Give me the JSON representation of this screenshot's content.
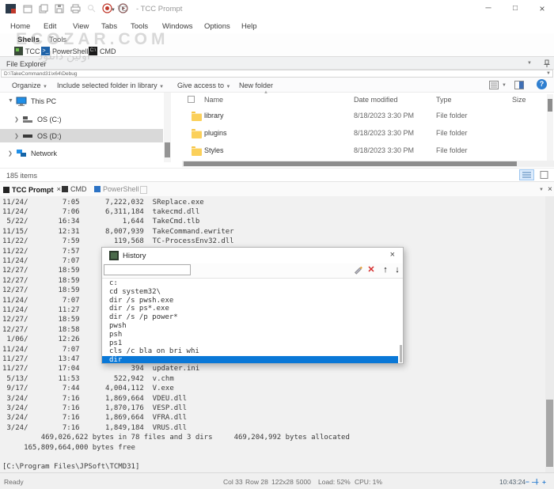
{
  "window": {
    "title": "- TCC Prompt",
    "qat_label": "TC",
    "minimize": "─",
    "maximize": "□",
    "close": "×"
  },
  "menu": {
    "items": [
      "Home",
      "Edit",
      "View",
      "Tabs",
      "Tools",
      "Windows",
      "Options",
      "Help"
    ]
  },
  "ribbon": {
    "groups": [
      "Shells",
      "Tools"
    ],
    "shells": [
      "TCC",
      "PowerShell",
      "CMD"
    ]
  },
  "watermark": {
    "line1": "ECOZAR.COM",
    "line2": "اولین دانلود"
  },
  "explorer": {
    "panel_title": "File Explorer",
    "address": "D:\\TakeCommand31\\x64\\Debug",
    "toolbar": {
      "organize": "Organize",
      "include": "Include selected folder in library",
      "give_access": "Give access to",
      "new_folder": "New folder"
    },
    "tree": {
      "items": [
        "This PC",
        "OS (C:)",
        "OS (D:)",
        "Network"
      ]
    },
    "columns": [
      "Name",
      "Date modified",
      "Type",
      "Size"
    ],
    "files": [
      {
        "name": "library",
        "date": "8/18/2023 3:30 PM",
        "type": "File folder"
      },
      {
        "name": "plugins",
        "date": "8/18/2023 3:30 PM",
        "type": "File folder"
      },
      {
        "name": "Styles",
        "date": "8/18/2023 3:30 PM",
        "type": "File folder"
      }
    ],
    "status": "185 items"
  },
  "console_tabs": {
    "tab1": "TCC Prompt",
    "tab1_close": "×",
    "tab2": "CMD",
    "tab3": "PowerShell"
  },
  "console": {
    "lines": [
      "11/24/        7:05      7,222,032  SReplace.exe",
      "11/24/        7:06      6,311,184  takecmd.dll",
      " 5/22/       16:34          1,644  TakeCmd.tlb",
      "11/15/       12:31      8,007,939  TakeCommand.ewriter",
      "11/22/        7:59        119,568  TC-ProcessEnv32.dll",
      "11/22/        7:57",
      "11/24/        7:07",
      "12/27/       18:59",
      "12/27/       18:59",
      "12/27/       18:59",
      "11/24/        7:07",
      "11/24/       11:27",
      "12/27/       18:59",
      "12/27/       18:58",
      " 1/06/       12:26",
      "11/24/        7:07",
      "11/27/       13:47",
      "11/27/       17:04            394  updater.ini",
      " 5/13/       11:53        522,942  v.chm",
      " 9/17/        7:44      4,004,112  V.exe",
      " 3/24/        7:16      1,869,664  VDEU.dll",
      " 3/24/        7:16      1,870,176  VESP.dll",
      " 3/24/        7:16      1,869,664  VFRA.dll",
      " 3/24/        7:16      1,849,184  VRUS.dll",
      "         469,026,622 bytes in 78 files and 3 dirs     469,204,992 bytes allocated",
      "     165,809,664,000 bytes free",
      "",
      "[C:\\Program Files\\JPSoft\\TCMD31]"
    ]
  },
  "history": {
    "title": "History",
    "close": "×",
    "items": [
      "c:",
      "cd system32\\",
      "dir /s pwsh.exe",
      "dir /s ps*.exe",
      "dir /s /p power*",
      "pwsh",
      "psh",
      "ps1",
      "cls /c bla on bri whi",
      "dir"
    ]
  },
  "statusbar": {
    "ready": "Ready",
    "col": "Col 33",
    "row": "Row 28",
    "dims": "122x28",
    "buffer": "5000",
    "load": "Load: 52%",
    "cpu": "CPU: 1%",
    "time": "10:43:24"
  }
}
